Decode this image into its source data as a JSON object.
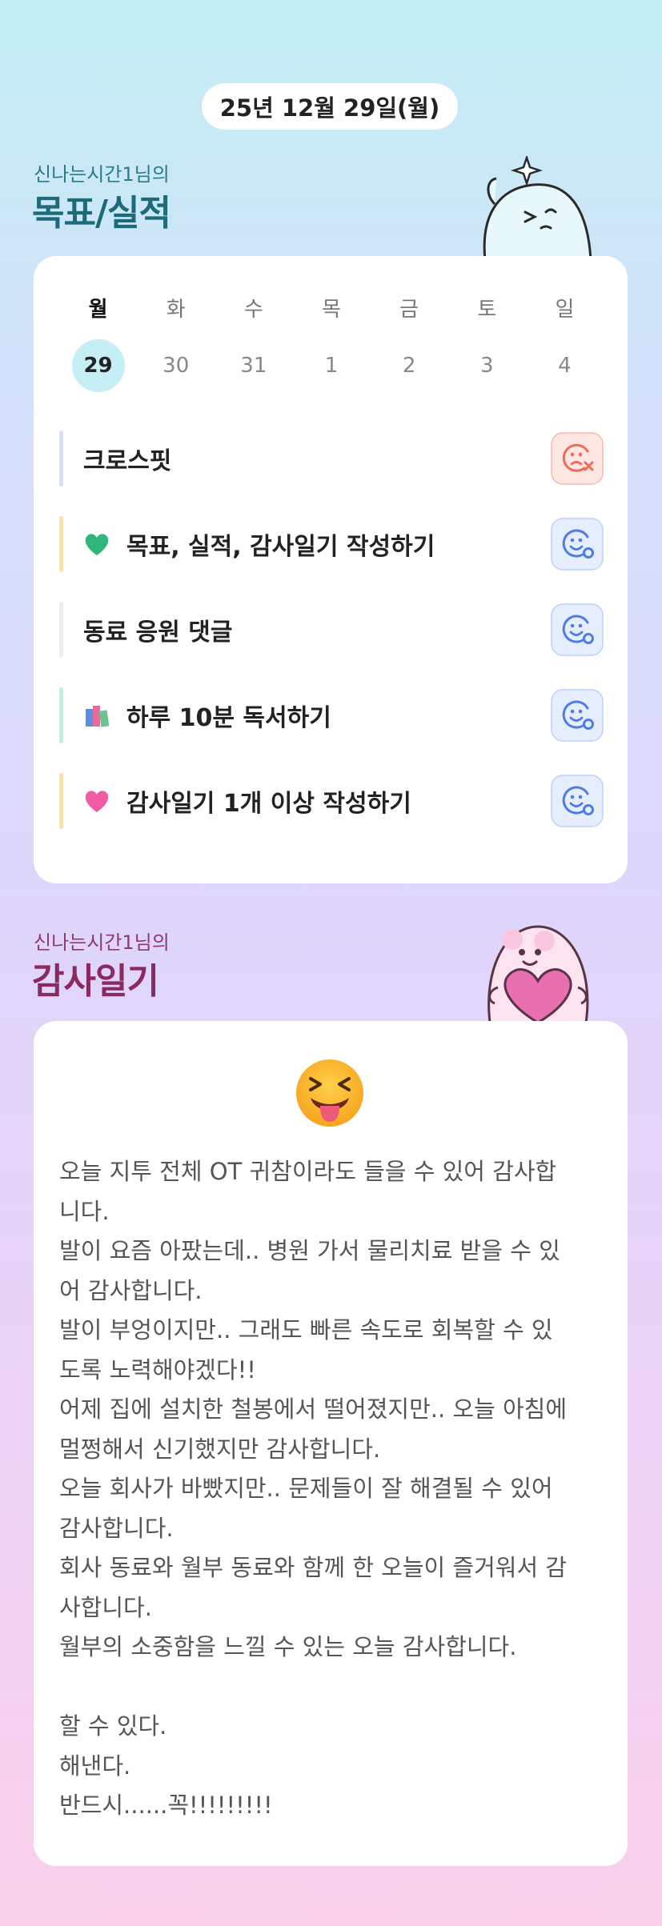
{
  "date": "25년 12월 29일(월)",
  "goals_section": {
    "subtitle": "신나는시간1님의",
    "title": "목표/실적"
  },
  "week": {
    "days": [
      {
        "name": "월",
        "num": "29",
        "today": true
      },
      {
        "name": "화",
        "num": "30"
      },
      {
        "name": "수",
        "num": "31"
      },
      {
        "name": "목",
        "num": "1"
      },
      {
        "name": "금",
        "num": "2"
      },
      {
        "name": "토",
        "num": "3"
      },
      {
        "name": "일",
        "num": "4"
      }
    ]
  },
  "goals": [
    {
      "label": "크로스핏",
      "bar_color": "#d6e1f5",
      "status": "failed"
    },
    {
      "label": "목표, 실적, 감사일기 작성하기",
      "bar_color": "#f9dfae",
      "icon": "green-heart-icon",
      "status": "pending"
    },
    {
      "label": "동료 응원 댓글",
      "bar_color": "#eeeeee",
      "status": "pending"
    },
    {
      "label": "하루 10분 독서하기",
      "bar_color": "#c6ecdf",
      "icon": "books-icon",
      "status": "pending"
    },
    {
      "label": "감사일기 1개 이상 작성하기",
      "bar_color": "#f9dfae",
      "icon": "pink-heart-icon",
      "status": "pending"
    }
  ],
  "diary_section": {
    "subtitle": "신나는시간1님의",
    "title": "감사일기"
  },
  "diary": {
    "mood_icon": "squinting-tongue-face-icon",
    "text": "오늘 지투 전체 OT 귀참이라도 들을 수 있어 감사합\n니다.\n발이 요즘 아팠는데.. 병원 가서 물리치료 받을 수 있\n어 감사합니다.\n발이 부엉이지만.. 그래도 빠른 속도로 회복할 수 있\n도록 노력해야겠다!!\n어제 집에 설치한 철봉에서 떨어졌지만.. 오늘 아침에\n멀쩡해서 신기했지만 감사합니다.\n오늘 회사가 바빴지만.. 문제들이 잘 해결될 수 있어\n감사합니다.\n회사 동료와 월부 동료와 함께 한 오늘이 즐거워서 감\n사합니다.\n월부의 소중함을 느낄 수 있는 오늘 감사합니다.\n\n할 수 있다.\n해낸다.\n반드시......꼭!!!!!!!!!"
  },
  "colors": {
    "goals_title": "#1d6b78",
    "diary_title": "#8a2a60",
    "status_pending_bg": "#e6eefe",
    "status_pending_fg": "#4d7ce5",
    "status_failed_bg": "#fde7e3",
    "status_failed_fg": "#ef6b58"
  }
}
